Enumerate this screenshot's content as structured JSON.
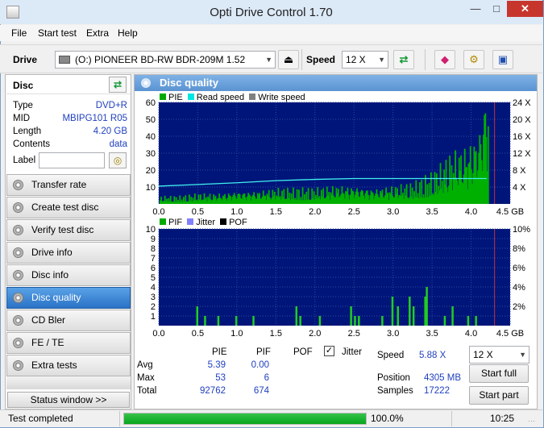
{
  "window": {
    "title": "Opti Drive Control 1.70"
  },
  "menu": [
    "File",
    "Start test",
    "Extra",
    "Help"
  ],
  "toolbar": {
    "drive_label": "Drive",
    "drive_value": "(O:)  PIONEER BD-RW   BDR-209M 1.52",
    "speed_label": "Speed",
    "speed_value": "12 X"
  },
  "disc": {
    "header": "Disc",
    "rows": [
      {
        "key": "Type",
        "value": "DVD+R"
      },
      {
        "key": "MID",
        "value": "MBIPG101 R05"
      },
      {
        "key": "Length",
        "value": "4.20 GB"
      },
      {
        "key": "Contents",
        "value": "data"
      }
    ],
    "label_key": "Label",
    "label_value": ""
  },
  "nav": [
    {
      "label": "Transfer rate",
      "active": false
    },
    {
      "label": "Create test disc",
      "active": false
    },
    {
      "label": "Verify test disc",
      "active": false
    },
    {
      "label": "Drive info",
      "active": false
    },
    {
      "label": "Disc info",
      "active": false
    },
    {
      "label": "Disc quality",
      "active": true
    },
    {
      "label": "CD Bler",
      "active": false
    },
    {
      "label": "FE / TE",
      "active": false
    },
    {
      "label": "Extra tests",
      "active": false
    }
  ],
  "status_window_button": "Status window >>",
  "panel_title": "Disc quality",
  "chart_data": [
    {
      "type": "bar",
      "legend": [
        {
          "name": "PIE",
          "color": "#00aa00"
        },
        {
          "name": "Read speed",
          "color": "#00e5e5"
        },
        {
          "name": "Write speed",
          "color": "#808080"
        }
      ],
      "x_ticks": [
        "0.0",
        "0.5",
        "1.0",
        "1.5",
        "2.0",
        "2.5",
        "3.0",
        "3.5",
        "4.0",
        "4.5 GB"
      ],
      "y_ticks_left": [
        "60",
        "50",
        "40",
        "30",
        "20",
        "10"
      ],
      "y_ticks_right": [
        "24 X",
        "20 X",
        "16 X",
        "12 X",
        "8 X",
        "4 X"
      ],
      "xlim": [
        0,
        4.5
      ],
      "ylim": [
        0,
        60
      ],
      "series": [
        {
          "name": "PIE",
          "x": [
            0.0,
            0.25,
            0.5,
            0.75,
            1.0,
            1.25,
            1.5,
            1.75,
            2.0,
            2.25,
            2.5,
            2.75,
            3.0,
            3.25,
            3.5,
            3.6,
            3.75,
            3.9,
            4.0,
            4.1,
            4.2
          ],
          "values": [
            3,
            3,
            4,
            4,
            5,
            5,
            6,
            6,
            6,
            7,
            7,
            6,
            7,
            8,
            12,
            15,
            20,
            22,
            25,
            30,
            50
          ]
        },
        {
          "name": "Read speed",
          "x": [
            0.0,
            0.5,
            1.0,
            1.5,
            2.0,
            2.5,
            3.0,
            3.5,
            4.0,
            4.2
          ],
          "values": [
            4.2,
            4.6,
            5.0,
            5.5,
            5.8,
            6.0,
            6.0,
            6.0,
            6.0,
            6.0
          ]
        }
      ],
      "marker_x": 4.3
    },
    {
      "type": "bar",
      "legend": [
        {
          "name": "PIF",
          "color": "#00aa00"
        },
        {
          "name": "Jitter",
          "color": "#8080ff"
        },
        {
          "name": "POF",
          "color": "#000000"
        }
      ],
      "x_ticks": [
        "0.0",
        "0.5",
        "1.0",
        "1.5",
        "2.0",
        "2.5",
        "3.0",
        "3.5",
        "4.0",
        "4.5 GB"
      ],
      "y_ticks_left": [
        "10",
        "9",
        "8",
        "7",
        "6",
        "5",
        "4",
        "3",
        "2",
        "1"
      ],
      "y_ticks_right": [
        "10%",
        "8%",
        "6%",
        "4%",
        "2%"
      ],
      "xlim": [
        0,
        4.5
      ],
      "ylim": [
        0,
        10
      ],
      "series": [
        {
          "name": "PIF",
          "x": [
            0.48,
            0.58,
            0.75,
            0.98,
            1.2,
            1.75,
            1.8,
            2.05,
            2.45,
            2.5,
            2.55,
            2.85,
            2.98,
            3.05,
            3.2,
            3.25,
            3.4,
            3.42,
            3.65,
            3.75,
            3.95,
            4.05
          ],
          "values": [
            2,
            1,
            1,
            1,
            1,
            2,
            1,
            1,
            2,
            1,
            1,
            1,
            3,
            2,
            3,
            2,
            3,
            4,
            1,
            2,
            1,
            1
          ]
        }
      ],
      "marker_x": 4.3
    }
  ],
  "stats": {
    "col_headers": [
      "PIE",
      "PIF",
      "POF",
      "Jitter"
    ],
    "rows": [
      {
        "label": "Avg",
        "pie": "5.39",
        "pif": "0.00"
      },
      {
        "label": "Max",
        "pie": "53",
        "pif": "6"
      },
      {
        "label": "Total",
        "pie": "92762",
        "pif": "674"
      }
    ],
    "speed_label": "Speed",
    "speed_value": "5.88 X",
    "position_label": "Position",
    "position_value": "4305 MB",
    "samples_label": "Samples",
    "samples_value": "17222",
    "speed_select": "12 X",
    "start_full": "Start full",
    "start_part": "Start part"
  },
  "statusbar": {
    "text": "Test completed",
    "progress": 1.0,
    "percent": "100.0%",
    "time": "10:25"
  }
}
